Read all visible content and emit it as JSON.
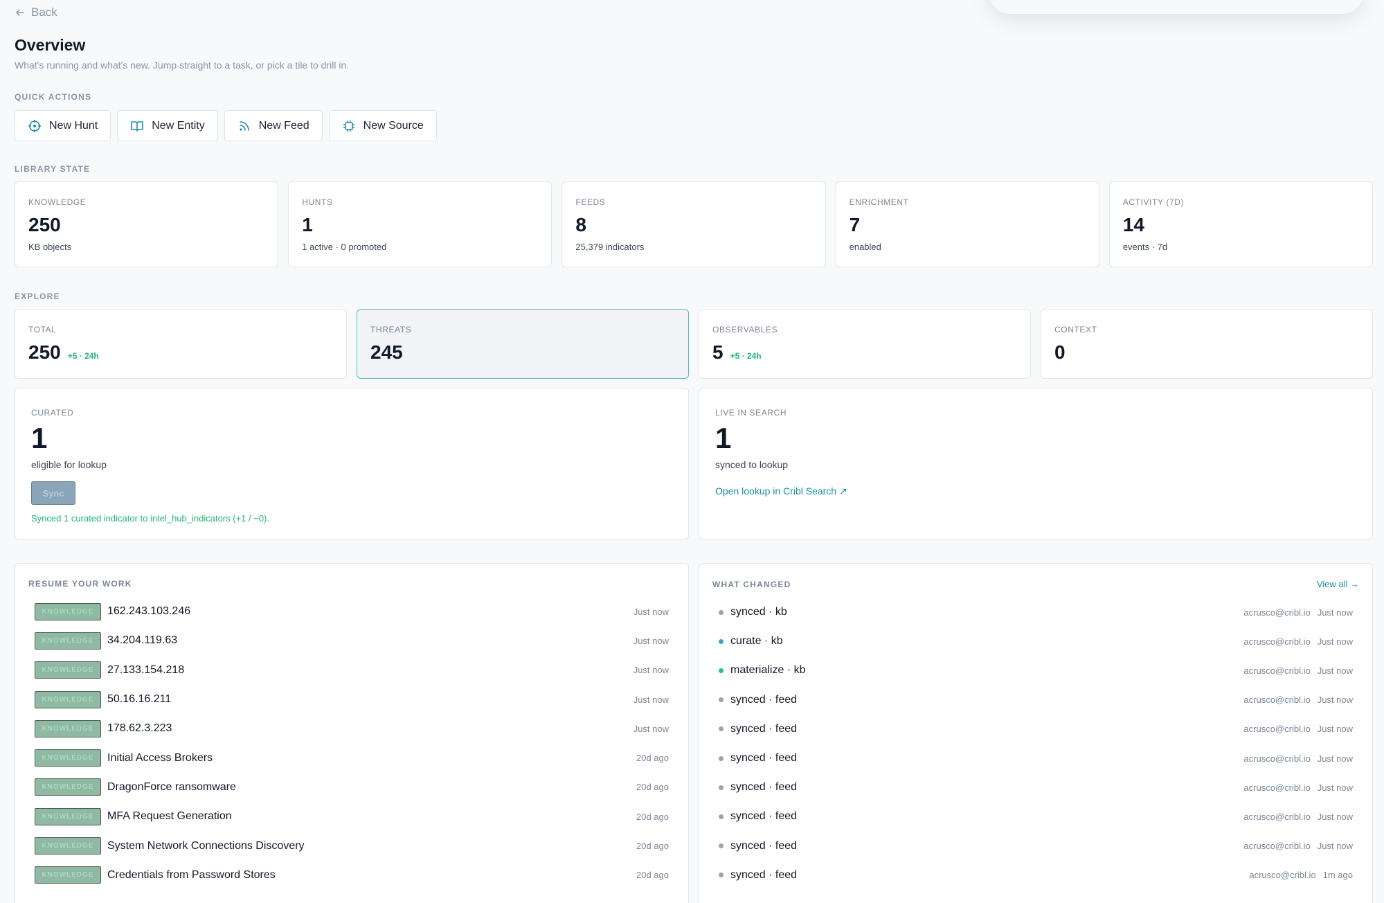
{
  "nav": {
    "back_label": "Back"
  },
  "header": {
    "title": "Overview",
    "subtitle": "What's running and what's new. Jump straight to a task, or pick a tile to drill in."
  },
  "quick_actions": {
    "label": "QUICK ACTIONS",
    "buttons": [
      {
        "label": "New Hunt",
        "icon": "crosshair-icon"
      },
      {
        "label": "New Entity",
        "icon": "book-icon"
      },
      {
        "label": "New Feed",
        "icon": "rss-icon"
      },
      {
        "label": "New Source",
        "icon": "chip-icon"
      }
    ]
  },
  "library_state": {
    "label": "LIBRARY STATE",
    "cards": [
      {
        "label": "KNOWLEDGE",
        "value": "250",
        "sub": "KB objects"
      },
      {
        "label": "HUNTS",
        "value": "1",
        "sub": "1 active · 0 promoted"
      },
      {
        "label": "FEEDS",
        "value": "8",
        "sub": "25,379 indicators"
      },
      {
        "label": "ENRICHMENT",
        "value": "7",
        "sub": "enabled"
      },
      {
        "label": "ACTIVITY (7D)",
        "value": "14",
        "sub": "events · 7d"
      }
    ]
  },
  "explore": {
    "label": "EXPLORE",
    "cards": [
      {
        "label": "TOTAL",
        "value": "250",
        "delta": "+5 · 24h"
      },
      {
        "label": "THREATS",
        "value": "245",
        "delta": ""
      },
      {
        "label": "OBSERVABLES",
        "value": "5",
        "delta": "+5 · 24h"
      },
      {
        "label": "CONTEXT",
        "value": "0",
        "delta": ""
      }
    ],
    "active_index": 1
  },
  "curated": {
    "label": "CURATED",
    "value": "1",
    "sub": "eligible for lookup",
    "button_label": "Sync",
    "message": "Synced 1 curated indicator to intel_hub_indicators (+1 / −0)."
  },
  "live_search": {
    "label": "LIVE IN SEARCH",
    "value": "1",
    "sub": "synced to lookup",
    "link": "Open lookup in Cribl Search ↗"
  },
  "resume": {
    "label": "RESUME YOUR WORK",
    "items": [
      {
        "badge": "KNOWLEDGE",
        "name": "162.243.103.246",
        "time": "Just now"
      },
      {
        "badge": "KNOWLEDGE",
        "name": "34.204.119.63",
        "time": "Just now"
      },
      {
        "badge": "KNOWLEDGE",
        "name": "27.133.154.218",
        "time": "Just now"
      },
      {
        "badge": "KNOWLEDGE",
        "name": "50.16.16.211",
        "time": "Just now"
      },
      {
        "badge": "KNOWLEDGE",
        "name": "178.62.3.223",
        "time": "Just now"
      },
      {
        "badge": "KNOWLEDGE",
        "name": "Initial Access Brokers",
        "time": "20d ago"
      },
      {
        "badge": "KNOWLEDGE",
        "name": "DragonForce ransomware",
        "time": "20d ago"
      },
      {
        "badge": "KNOWLEDGE",
        "name": "MFA Request Generation",
        "time": "20d ago"
      },
      {
        "badge": "KNOWLEDGE",
        "name": "System Network Connections Discovery",
        "time": "20d ago"
      },
      {
        "badge": "KNOWLEDGE",
        "name": "Credentials from Password Stores",
        "time": "20d ago"
      }
    ]
  },
  "changes": {
    "label": "WHAT CHANGED",
    "view_all": "View all →",
    "items": [
      {
        "event": "synced · kb",
        "user": "acrusco@cribl.io",
        "ago": "Just now",
        "dot_color": "#9aa3ae"
      },
      {
        "event": "curate · kb",
        "user": "acrusco@cribl.io",
        "ago": "Just now",
        "dot_color": "#3aa7c4"
      },
      {
        "event": "materialize · kb",
        "user": "acrusco@cribl.io",
        "ago": "Just now",
        "dot_color": "#22c08a"
      },
      {
        "event": "synced · feed",
        "user": "acrusco@cribl.io",
        "ago": "Just now",
        "dot_color": "#9aa3ae"
      },
      {
        "event": "synced · feed",
        "user": "acrusco@cribl.io",
        "ago": "Just now",
        "dot_color": "#9aa3ae"
      },
      {
        "event": "synced · feed",
        "user": "acrusco@cribl.io",
        "ago": "Just now",
        "dot_color": "#9aa3ae"
      },
      {
        "event": "synced · feed",
        "user": "acrusco@cribl.io",
        "ago": "Just now",
        "dot_color": "#9aa3ae"
      },
      {
        "event": "synced · feed",
        "user": "acrusco@cribl.io",
        "ago": "Just now",
        "dot_color": "#9aa3ae"
      },
      {
        "event": "synced · feed",
        "user": "acrusco@cribl.io",
        "ago": "Just now",
        "dot_color": "#9aa3ae"
      },
      {
        "event": "synced · feed",
        "user": "acrusco@cribl.io",
        "ago": "1m ago",
        "dot_color": "#9aa3ae"
      }
    ]
  },
  "colors": {
    "accent": "#1a8fa6",
    "positive": "#22b573",
    "badge_bg": "#8fb9a3"
  }
}
